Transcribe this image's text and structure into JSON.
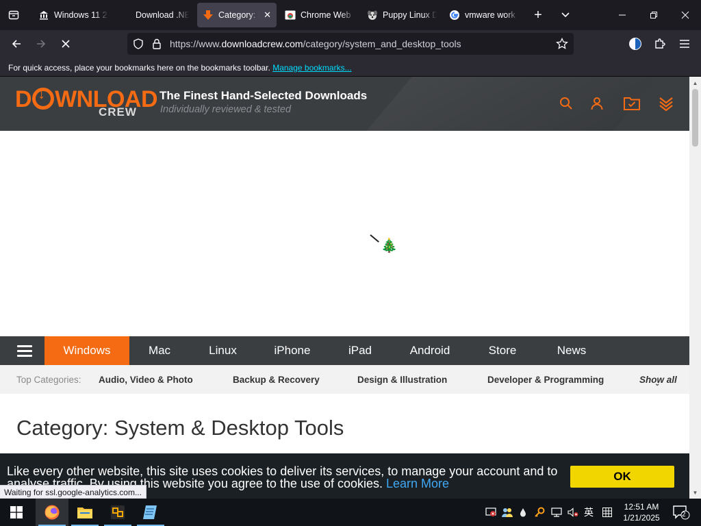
{
  "browser": {
    "tabs": [
      {
        "title": "Windows 11 2",
        "icon": "museum-icon"
      },
      {
        "title": "Download .NE",
        "icon": "none"
      },
      {
        "title": "Category: S",
        "icon": "downloadcrew-icon",
        "active": true
      },
      {
        "title": "Chrome Web",
        "icon": "chrome-web-store-icon"
      },
      {
        "title": "Puppy Linux D",
        "icon": "puppy-icon"
      },
      {
        "title": "vmware work",
        "icon": "google-icon"
      }
    ],
    "url_prefix": "https://www.",
    "url_domain": "downloadcrew.com",
    "url_path": "/category/system_and_desktop_tools",
    "bookmarks_text": "For quick access, place your bookmarks here on the bookmarks toolbar.",
    "bookmarks_link": "Manage bookmarks...",
    "status_text": "Waiting for ssl.google-analytics.com..."
  },
  "site": {
    "logo_top": "D",
    "logo_top_rest": "WNLOAD",
    "logo_bottom": "CREW",
    "tagline": "The Finest Hand-Selected Downloads",
    "subtagline": "Individually reviewed & tested",
    "brand_color": "#f46b14",
    "nav": [
      "Windows",
      "Mac",
      "Linux",
      "iPhone",
      "iPad",
      "Android",
      "Store",
      "News"
    ],
    "active_nav": "Windows",
    "top_categories_label": "Top Categories:",
    "top_categories": [
      "Audio, Video & Photo",
      "Backup & Recovery",
      "Design & Illustration",
      "Developer & Programming"
    ],
    "show_all": "Show all",
    "page_heading": "Category: System & Desktop Tools",
    "cookie_text": "Like every other website, this site uses cookies to deliver its services, to manage your account and to analyse traffic. By using this website you agree to the use of cookies.",
    "cookie_link": "Learn More",
    "cookie_ok": "OK"
  },
  "taskbar": {
    "time": "12:51 AM",
    "date": "1/21/2025",
    "ime": "英",
    "notification_count": "2"
  }
}
